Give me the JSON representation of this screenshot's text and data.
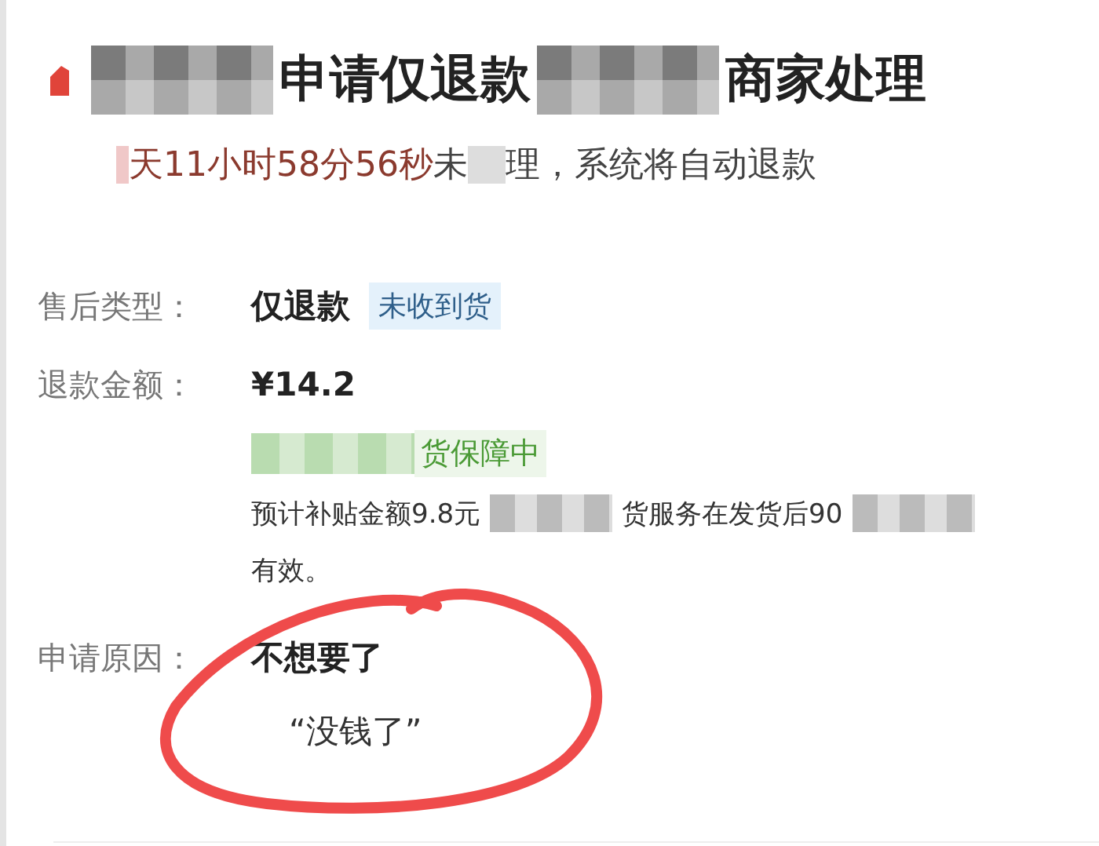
{
  "title": [
    {
      "kind": "icon"
    },
    {
      "kind": "mosaic"
    },
    {
      "kind": "text",
      "text": "申请仅退款"
    },
    {
      "kind": "mosaic"
    },
    {
      "kind": "text",
      "text": "商家处理"
    }
  ],
  "countdown": [
    {
      "kind": "mosaic"
    },
    {
      "kind": "time",
      "text": "天11小时58分56秒"
    },
    {
      "kind": "text",
      "text": "未"
    },
    {
      "kind": "mosaic"
    },
    {
      "kind": "text",
      "text": "理，系统将自动退款"
    }
  ],
  "fields": [
    {
      "label": "售后类型：",
      "value": "仅退款",
      "tag": "未收到货"
    },
    {
      "label": "退款金额：",
      "value": "¥14.2"
    }
  ],
  "guarantee": [
    {
      "kind": "mosaic"
    },
    {
      "kind": "text",
      "text": "货保障中"
    }
  ],
  "note_line_1": [
    {
      "kind": "text",
      "text": "预计补贴金额9.8元"
    },
    {
      "kind": "mosaic"
    },
    {
      "kind": "text",
      "text": "货服务在发货后90"
    },
    {
      "kind": "mosaic"
    }
  ],
  "note_line_2": "有效。",
  "reason": {
    "label": "申请原因：",
    "value": "不想要了",
    "comment": "“没钱了”"
  }
}
